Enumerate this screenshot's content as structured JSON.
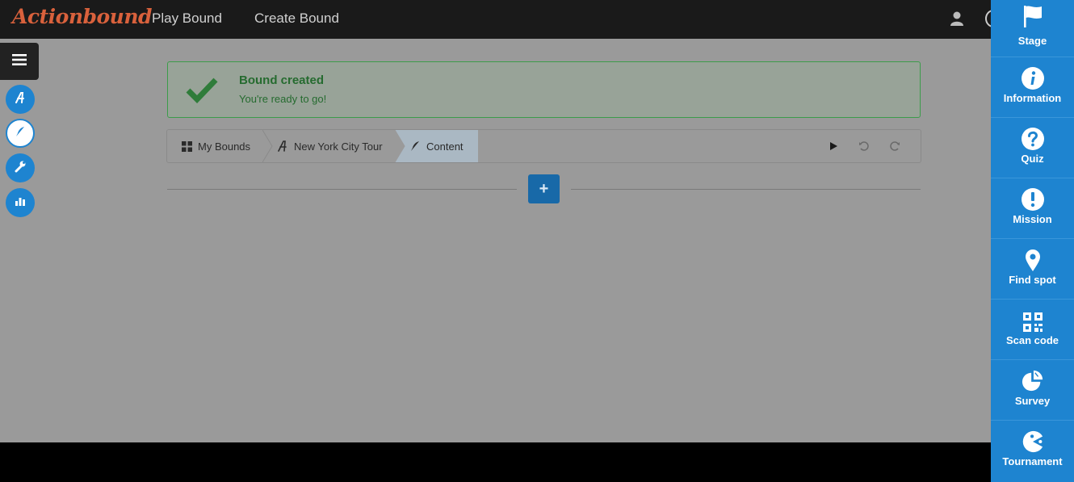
{
  "header": {
    "logo": "Actionbound",
    "nav": [
      {
        "label": "Play Bound"
      },
      {
        "label": "Create Bound"
      }
    ]
  },
  "alert": {
    "title": "Bound created",
    "message": "You're ready to go!"
  },
  "breadcrumb": {
    "items": [
      {
        "label": "My Bounds",
        "icon": "grid-icon"
      },
      {
        "label": "New York City Tour",
        "icon": "actionbound-a-icon"
      },
      {
        "label": "Content",
        "icon": "feather-icon"
      }
    ],
    "active_index": 2
  },
  "toolbar": {
    "play_icon": "play-icon",
    "undo_icon": "undo-icon",
    "redo_icon": "redo-icon",
    "add_label": "+"
  },
  "sidebar": {
    "buttons": [
      {
        "icon": "menu-icon"
      },
      {
        "icon": "actionbound-a-icon"
      },
      {
        "icon": "feather-icon",
        "active": true
      },
      {
        "icon": "wrench-icon"
      },
      {
        "icon": "bar-chart-icon"
      }
    ]
  },
  "element_panel": {
    "items": [
      {
        "label": "Stage",
        "icon": "flag-icon"
      },
      {
        "label": "Information",
        "icon": "info-icon"
      },
      {
        "label": "Quiz",
        "icon": "question-icon"
      },
      {
        "label": "Mission",
        "icon": "exclamation-icon"
      },
      {
        "label": "Find spot",
        "icon": "map-pin-icon"
      },
      {
        "label": "Scan code",
        "icon": "qr-code-icon"
      },
      {
        "label": "Survey",
        "icon": "pie-chart-icon"
      },
      {
        "label": "Tournament",
        "icon": "pacman-icon"
      }
    ]
  },
  "colors": {
    "accent": "#1e84d0",
    "logo": "#d9613c",
    "success": "#3c9c4a",
    "topbar": "#1a1a1a"
  }
}
